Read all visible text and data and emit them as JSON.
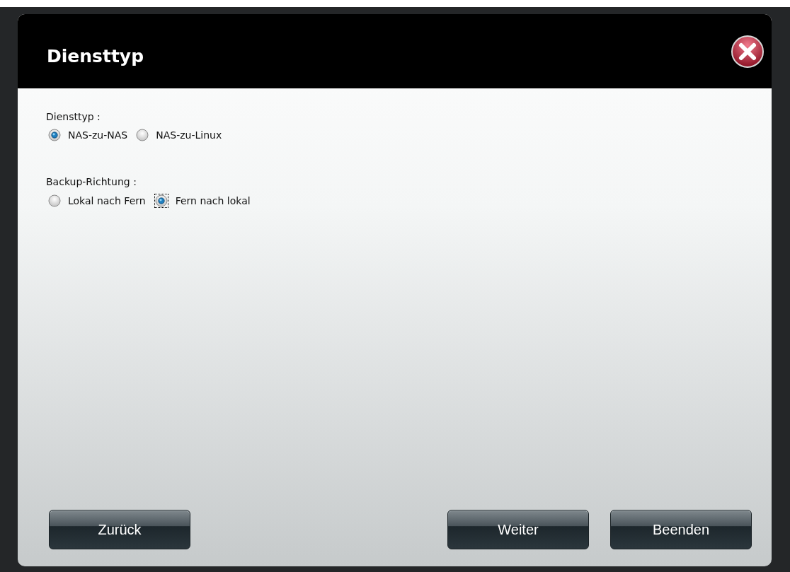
{
  "dialog": {
    "title": "Diensttyp"
  },
  "groups": [
    {
      "label": "Diensttyp :",
      "options": [
        {
          "label": "NAS-zu-NAS",
          "selected": true,
          "focused": false
        },
        {
          "label": "NAS-zu-Linux",
          "selected": false,
          "focused": false
        }
      ]
    },
    {
      "label": "Backup-Richtung :",
      "options": [
        {
          "label": "Lokal nach Fern",
          "selected": false,
          "focused": false
        },
        {
          "label": "Fern nach lokal",
          "selected": true,
          "focused": true
        }
      ]
    }
  ],
  "left_buttons": [
    "Zurück"
  ],
  "right_buttons": [
    "Weiter",
    "Beenden"
  ]
}
